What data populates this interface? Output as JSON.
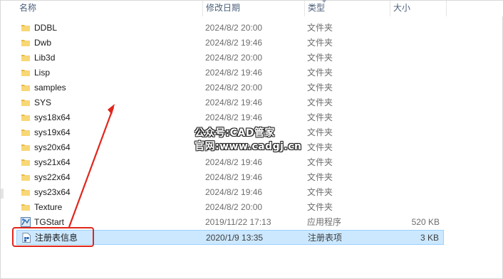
{
  "columns": {
    "name": "名称",
    "date": "修改日期",
    "type": "类型",
    "size": "大小"
  },
  "files": [
    {
      "name": "DDBL",
      "date": "2024/8/2 20:00",
      "type": "文件夹",
      "size": "",
      "icon": "folder-icon"
    },
    {
      "name": "Dwb",
      "date": "2024/8/2 19:46",
      "type": "文件夹",
      "size": "",
      "icon": "folder-icon"
    },
    {
      "name": "Lib3d",
      "date": "2024/8/2 20:00",
      "type": "文件夹",
      "size": "",
      "icon": "folder-icon"
    },
    {
      "name": "Lisp",
      "date": "2024/8/2 19:46",
      "type": "文件夹",
      "size": "",
      "icon": "folder-icon"
    },
    {
      "name": "samples",
      "date": "2024/8/2 20:00",
      "type": "文件夹",
      "size": "",
      "icon": "folder-icon"
    },
    {
      "name": "SYS",
      "date": "2024/8/2 19:46",
      "type": "文件夹",
      "size": "",
      "icon": "folder-icon"
    },
    {
      "name": "sys18x64",
      "date": "2024/8/2 19:46",
      "type": "文件夹",
      "size": "",
      "icon": "folder-icon"
    },
    {
      "name": "sys19x64",
      "date": "2024/8/2 19:46",
      "type": "文件夹",
      "size": "",
      "icon": "folder-icon"
    },
    {
      "name": "sys20x64",
      "date": "2024/8/2 19:46",
      "type": "文件夹",
      "size": "",
      "icon": "folder-icon"
    },
    {
      "name": "sys21x64",
      "date": "2024/8/2 19:46",
      "type": "文件夹",
      "size": "",
      "icon": "folder-icon"
    },
    {
      "name": "sys22x64",
      "date": "2024/8/2 19:46",
      "type": "文件夹",
      "size": "",
      "icon": "folder-icon"
    },
    {
      "name": "sys23x64",
      "date": "2024/8/2 19:46",
      "type": "文件夹",
      "size": "",
      "icon": "folder-icon"
    },
    {
      "name": "Texture",
      "date": "2024/8/2 20:00",
      "type": "文件夹",
      "size": "",
      "icon": "folder-icon"
    },
    {
      "name": "TGStart",
      "date": "2019/11/22 17:13",
      "type": "应用程序",
      "size": "520 KB",
      "icon": "application-icon"
    },
    {
      "name": "注册表信息",
      "date": "2020/1/9 13:35",
      "type": "注册表项",
      "size": "3 KB",
      "icon": "registry-file-icon"
    }
  ],
  "selected_index": 14,
  "watermark": {
    "line1": "公众号:CAD管家",
    "line2": "官网:www.cadgj.cn"
  },
  "colors": {
    "selection_bg": "#cce8ff",
    "selection_border": "#99d1ff",
    "folder": "#f8d775",
    "annotation": "#e0261c"
  }
}
